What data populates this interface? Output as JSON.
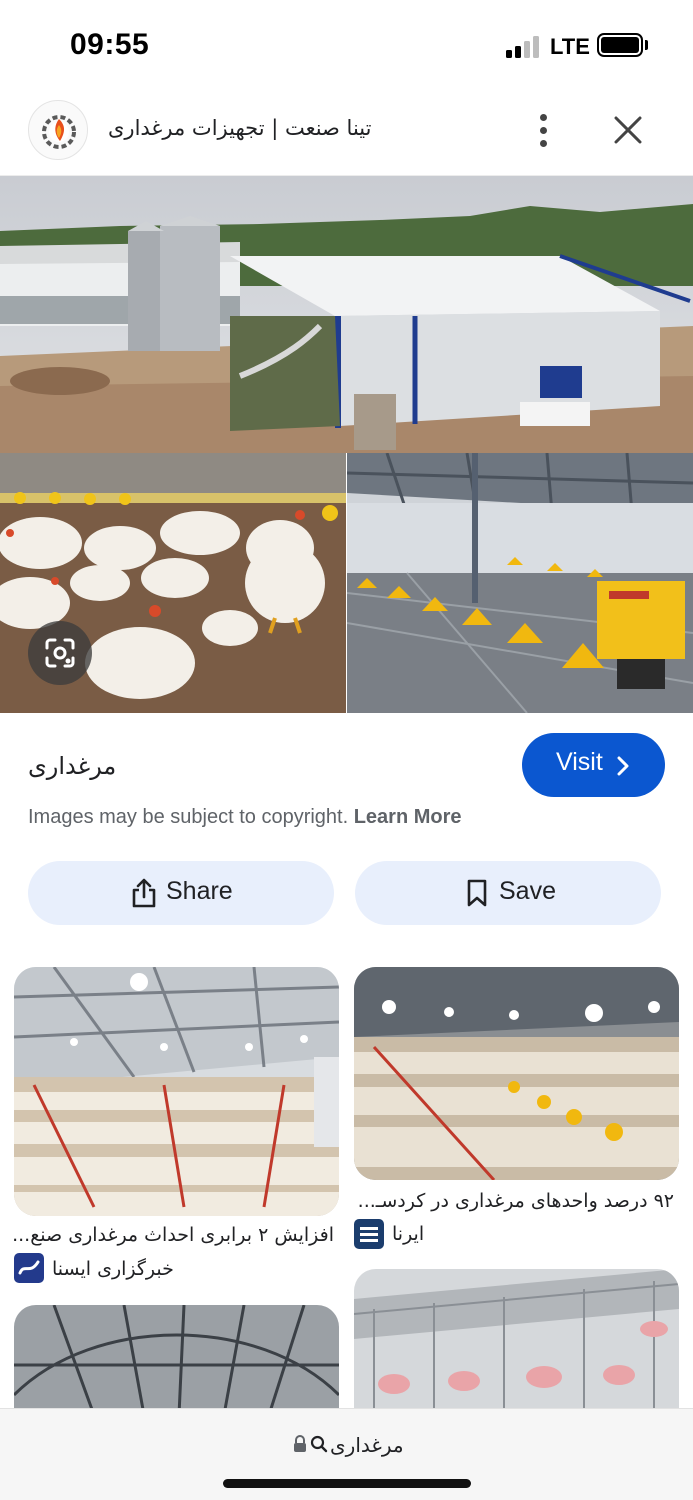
{
  "status_bar": {
    "time": "09:55",
    "network": "LTE",
    "battery_level": 1.0
  },
  "header": {
    "site_title": "تینا صنعت | تجهیزات مرغداری",
    "logo_icon": "tina-sanat-logo-icon",
    "more_icon": "more-vert-icon",
    "close_icon": "close-icon"
  },
  "main_image": {
    "lens_icon": "google-lens-icon"
  },
  "info": {
    "title": "مرغداری",
    "visit_label": "Visit",
    "copyright_text": "Images may be subject to copyright.",
    "learn_more": "Learn More",
    "share_label": "Share",
    "save_label": "Save"
  },
  "related": [
    {
      "title": "افزایش ۲ برابری احداث مرغداری صنع...",
      "source": "خبرگزاری ایسنا"
    },
    {
      "title": "۹۲ درصد واحدهای مرغداری در کردسـ...",
      "source": "ایرنا"
    }
  ],
  "bottom_bar": {
    "url_text": "مرغداری"
  },
  "colors": {
    "accent": "#0b57d0",
    "pill": "#e8effc",
    "text": "#202124",
    "muted": "#5f6368"
  }
}
